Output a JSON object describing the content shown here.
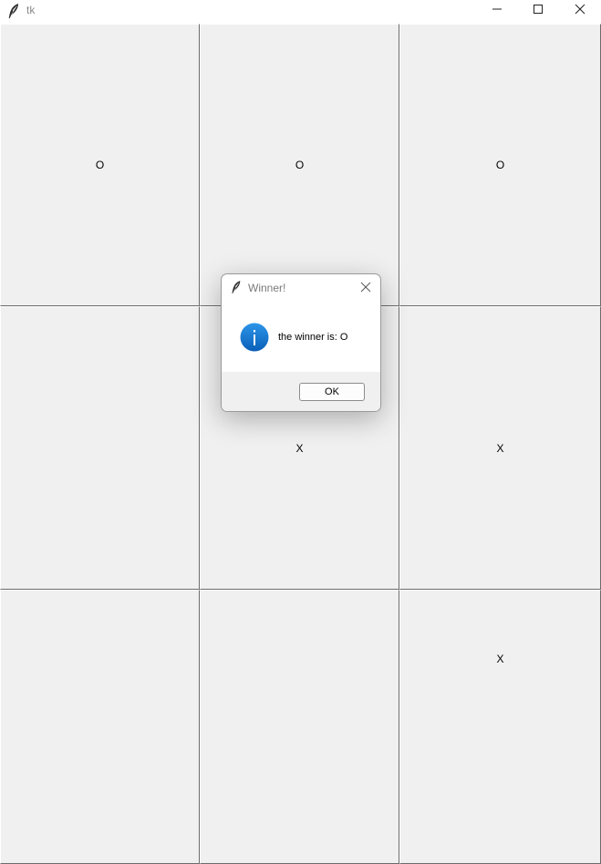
{
  "window": {
    "title": "tk",
    "icon": "feather-icon",
    "controls": [
      "minimize-icon",
      "maximize-icon",
      "close-icon"
    ]
  },
  "board": {
    "cells": [
      [
        "O",
        "O",
        "O"
      ],
      [
        "",
        "X",
        "X"
      ],
      [
        "",
        "",
        "X"
      ]
    ]
  },
  "dialog": {
    "title": "Winner!",
    "title_icon": "feather-icon",
    "icon": "info-icon",
    "message": "the winner is: O",
    "ok_label": "OK",
    "accent_color": "#1a73d2"
  }
}
